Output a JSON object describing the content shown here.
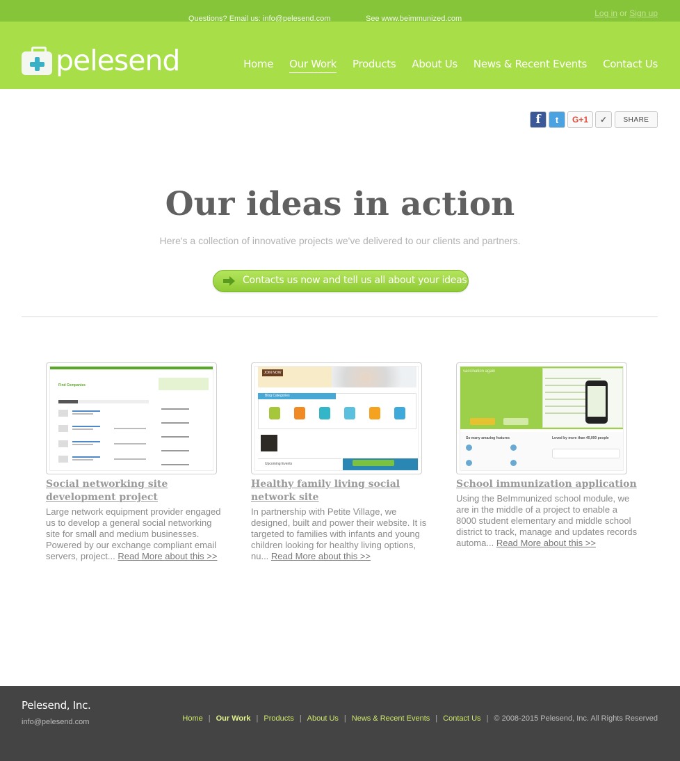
{
  "topbar": {
    "questions": "Questions? Email us: info@pelesend.com",
    "see": "See www.beimmunized.com",
    "login": "Log in",
    "or": "or",
    "signup": "Sign up"
  },
  "brand": {
    "name": "pelesend"
  },
  "nav": [
    {
      "label": "Home"
    },
    {
      "label": "Our Work",
      "active": true
    },
    {
      "label": "Products"
    },
    {
      "label": "About Us"
    },
    {
      "label": "News & Recent Events"
    },
    {
      "label": "Contact Us"
    }
  ],
  "share": {
    "facebook": "f",
    "twitter": "t",
    "gplus": "G+1",
    "mail": "✓",
    "share": "SHARE"
  },
  "hero": {
    "title": "Our ideas in action",
    "subtitle": "Here's a collection of innovative projects we've delivered to our clients and partners.",
    "cta": "Contacts us now and tell us all about your ideas"
  },
  "projects": [
    {
      "title": "Social networking site development project",
      "desc": "Large network equipment provider engaged us to develop a general social networking site for small and medium businesses. Powered by our exchange compliant email servers, project...",
      "more": "Read More about this >>"
    },
    {
      "title": "Healthy family living social network site",
      "desc": "In partnership with Petite Village, we designed, built and power their website. It is targeted to families with infants and young children looking for healthy living options, nu...",
      "more": "Read More about this >>"
    },
    {
      "title": "School immunization application",
      "desc": "Using the BeImmunized school module, we are in the middle of a project to enable a 8000 student elementary and middle school district to track, manage and updates records automa...",
      "more": "Read More about this >>"
    }
  ],
  "shots": {
    "s1_heading": "Find Companies",
    "s2_join": "JOIN NOW",
    "s2_bar": "Blog Categories",
    "s2_events": "Upcoming Events",
    "s3_heading": "vaccination again",
    "s3_features": "So many amazing features",
    "s3_loved": "Loved by more than 40,000 people"
  },
  "footer": {
    "company": "Pelesend, Inc.",
    "email": "info@pelesend.com",
    "links": [
      {
        "label": "Home"
      },
      {
        "label": "Our Work",
        "active": true
      },
      {
        "label": "Products"
      },
      {
        "label": "About Us"
      },
      {
        "label": "News & Recent Events"
      },
      {
        "label": "Contact Us"
      }
    ],
    "copyright": "© 2008-2015 Pelesend, Inc. All Rights Reserved"
  },
  "colors": {
    "header_green": "#a8de47",
    "topbar_green": "#86c43a",
    "footer_gray": "#444444",
    "cta_green": "#8fcb34"
  }
}
